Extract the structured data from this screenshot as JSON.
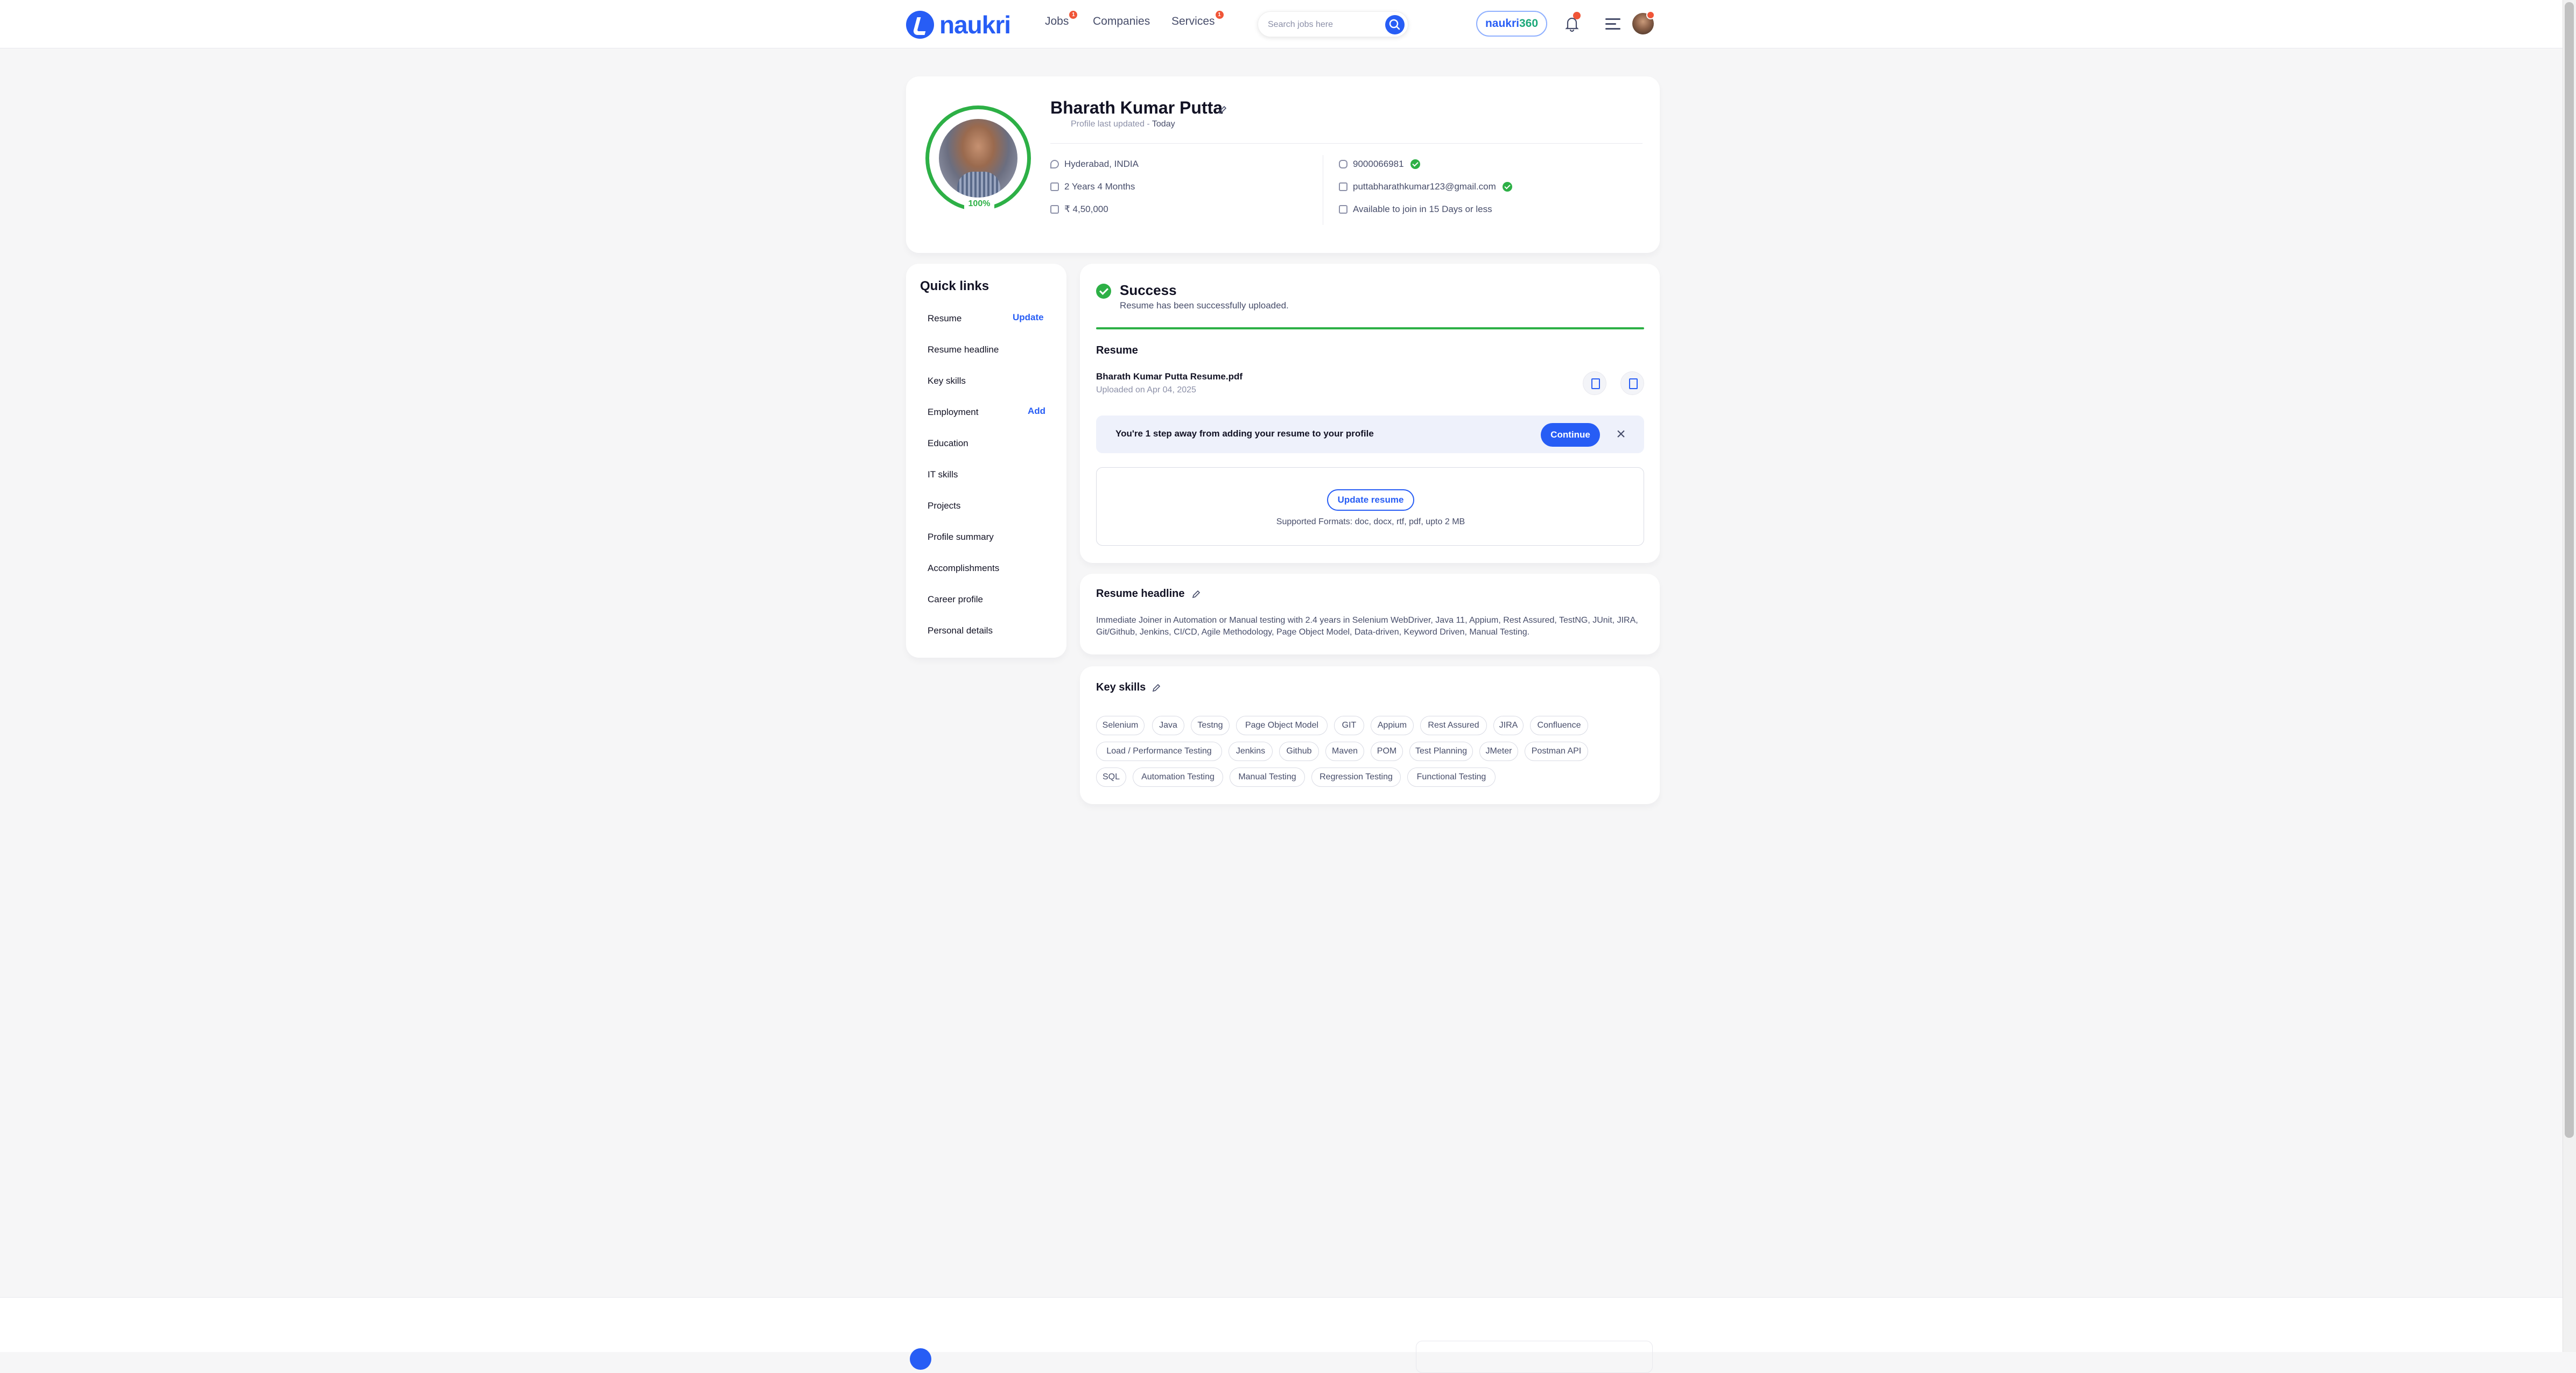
{
  "header": {
    "logo_text": "naukri",
    "nav": [
      {
        "label": "Jobs",
        "badge": "1"
      },
      {
        "label": "Companies",
        "badge": ""
      },
      {
        "label": "Services",
        "badge": "1"
      }
    ],
    "search_placeholder": "Search jobs here",
    "naukri360_a": "naukri",
    "naukri360_b": "360",
    "bell_badge": "1",
    "avatar_badge": "1"
  },
  "profile": {
    "name": "Bharath Kumar Putta",
    "updated_label": "Profile last updated - ",
    "updated_value": "Today",
    "completion": "100%",
    "location": "Hyderabad, INDIA",
    "experience": "2 Years 4 Months",
    "salary": "₹ 4,50,000",
    "phone": "9000066981",
    "email": "puttabharathkumar123@gmail.com",
    "availability": "Available to join in 15 Days or less"
  },
  "quick_links": {
    "title": "Quick links",
    "items": [
      {
        "label": "Resume",
        "action": "Update"
      },
      {
        "label": "Resume headline",
        "action": ""
      },
      {
        "label": "Key skills",
        "action": ""
      },
      {
        "label": "Employment",
        "action": "Add"
      },
      {
        "label": "Education",
        "action": ""
      },
      {
        "label": "IT skills",
        "action": ""
      },
      {
        "label": "Projects",
        "action": ""
      },
      {
        "label": "Profile summary",
        "action": ""
      },
      {
        "label": "Accomplishments",
        "action": ""
      },
      {
        "label": "Career profile",
        "action": ""
      },
      {
        "label": "Personal details",
        "action": ""
      }
    ]
  },
  "resume": {
    "success_title": "Success",
    "success_msg": "Resume has been successfully uploaded.",
    "section_title": "Resume",
    "file_name": "Bharath Kumar Putta Resume.pdf",
    "file_date": "Uploaded on Apr 04, 2025",
    "banner_text": "You're 1 step away from adding your resume to your profile",
    "continue_label": "Continue",
    "close_glyph": "×",
    "update_label": "Update resume",
    "formats": "Supported Formats: doc, docx, rtf, pdf, upto 2 MB"
  },
  "headline": {
    "title": "Resume headline",
    "text": "Immediate Joiner in Automation or Manual testing with 2.4 years in Selenium WebDriver, Java 11, Appium, Rest Assured, TestNG, JUnit, JIRA, Git/Github, Jenkins, CI/CD, Agile Methodology, Page Object Model, Data-driven, Keyword Driven, Manual Testing."
  },
  "skills": {
    "title": "Key skills",
    "items": [
      "Selenium",
      "Java",
      "Testng",
      "Page Object Model",
      "GIT",
      "Appium",
      "Rest Assured",
      "JIRA",
      "Confluence",
      "Load / Performance Testing",
      "Jenkins",
      "Github",
      "Maven",
      "POM",
      "Test Planning",
      "JMeter",
      "Postman API",
      "SQL",
      "Automation Testing",
      "Manual Testing",
      "Regression Testing",
      "Functional Testing"
    ]
  },
  "colors": {
    "brand": "#275df5",
    "success": "#2db046",
    "badge": "#f05537"
  }
}
